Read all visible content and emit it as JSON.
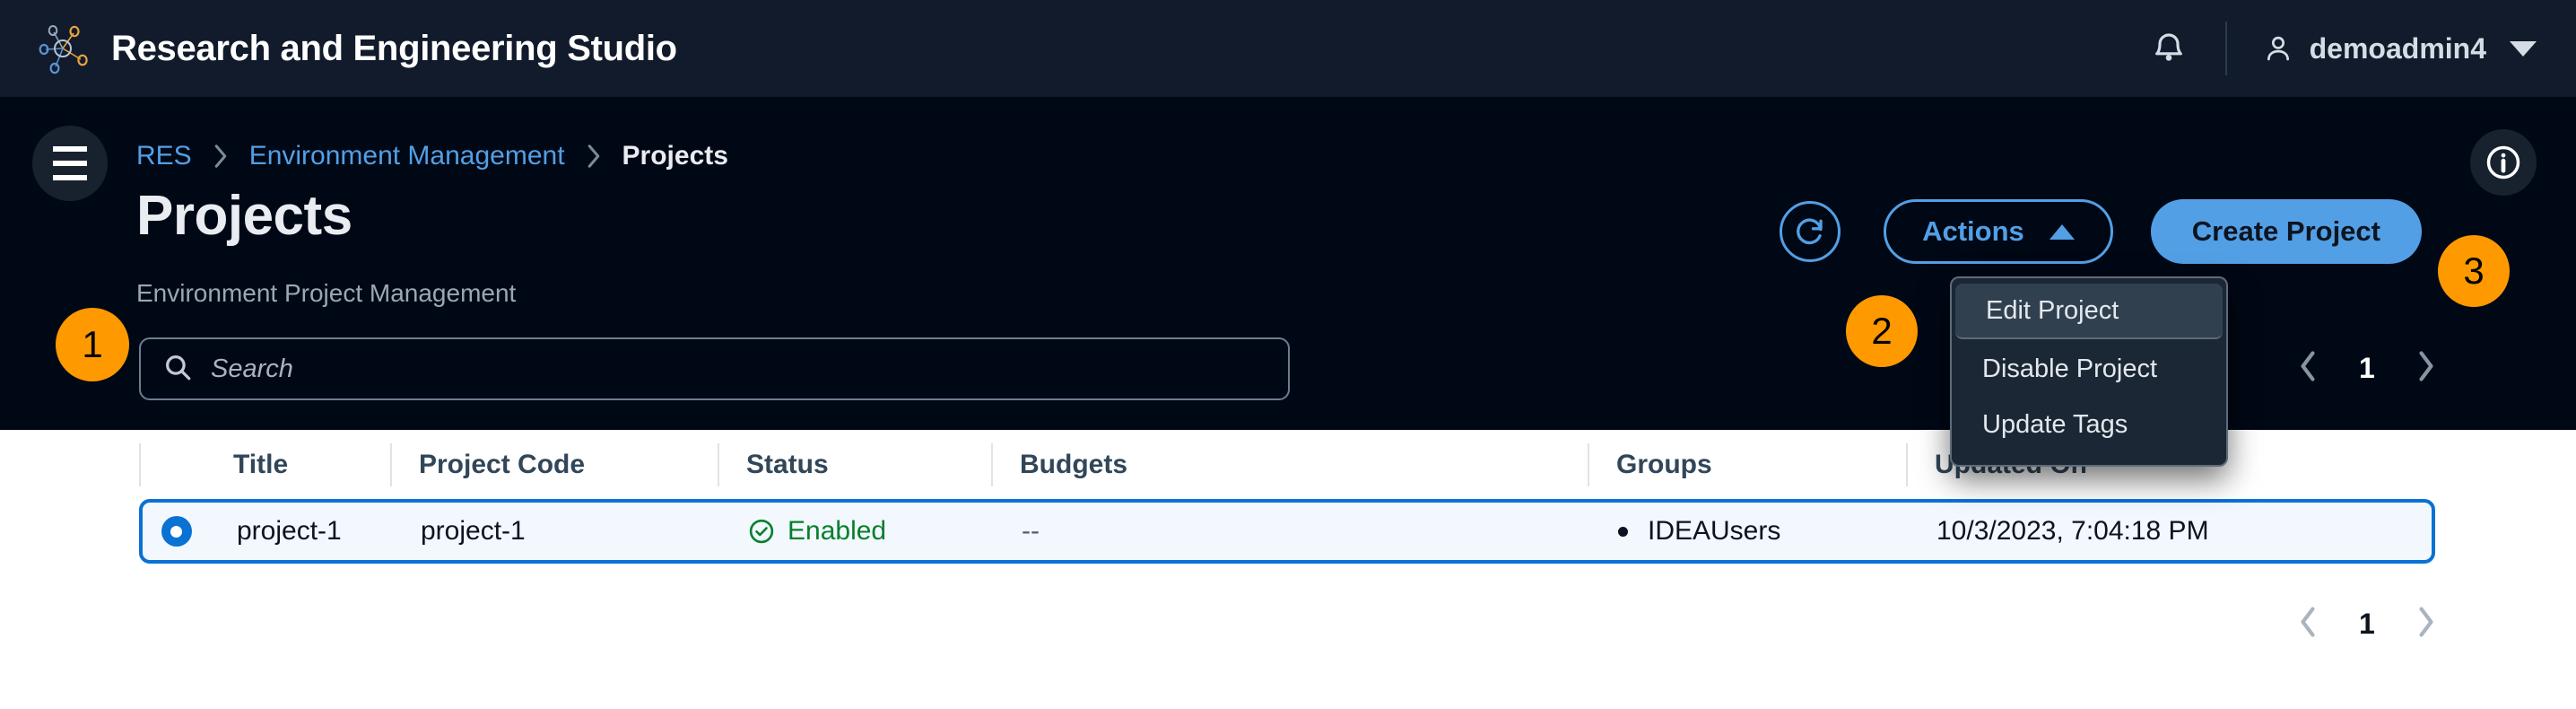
{
  "topbar": {
    "logo_icon": "network-nodes-logo",
    "app_title": "Research and Engineering Studio",
    "notifications_icon": "bell-icon",
    "user_icon": "user-icon",
    "user_name": "demoadmin4",
    "user_caret_icon": "chevron-down-icon"
  },
  "nav": {
    "menu_icon": "hamburger-menu-icon",
    "info_icon": "info-circle-icon",
    "breadcrumb": [
      {
        "label": "RES",
        "current": false
      },
      {
        "label": "Environment Management",
        "current": false
      },
      {
        "label": "Projects",
        "current": true
      }
    ],
    "breadcrumb_separator_icon": "chevron-right-icon"
  },
  "page": {
    "title": "Projects",
    "subtitle": "Environment Project Management"
  },
  "search": {
    "icon": "search-icon",
    "placeholder": "Search",
    "value": ""
  },
  "toolbar": {
    "refresh_icon": "refresh-icon",
    "actions_label": "Actions",
    "actions_caret_icon": "chevron-up-icon",
    "create_label": "Create Project"
  },
  "dropdown": {
    "items": [
      {
        "label": "Edit Project",
        "active": true
      },
      {
        "label": "Disable Project",
        "active": false
      },
      {
        "label": "Update Tags",
        "active": false
      }
    ]
  },
  "annotations": [
    {
      "id": "1",
      "label": "1"
    },
    {
      "id": "2",
      "label": "2"
    },
    {
      "id": "3",
      "label": "3"
    }
  ],
  "pagination": {
    "prev_icon": "chevron-left-icon",
    "next_icon": "chevron-right-icon",
    "current_page": "1"
  },
  "table": {
    "columns": [
      "Title",
      "Project Code",
      "Status",
      "Budgets",
      "Groups",
      "Updated On"
    ],
    "rows": [
      {
        "selected": true,
        "select_icon": "radio-selected-icon",
        "title": "project-1",
        "project_code": "project-1",
        "status": "Enabled",
        "status_icon": "check-circle-icon",
        "budgets": "--",
        "groups": "IDEAUsers",
        "updated_on": "10/3/2023, 7:04:18 PM"
      }
    ]
  },
  "colors": {
    "topbar_bg": "#111b2b",
    "panel_bg": "#000815",
    "link_blue": "#539fe5",
    "accent_blue": "#0972d3",
    "badge_orange": "#ff9900",
    "status_green": "#067f2c",
    "row_bg": "#f2f8fd"
  }
}
